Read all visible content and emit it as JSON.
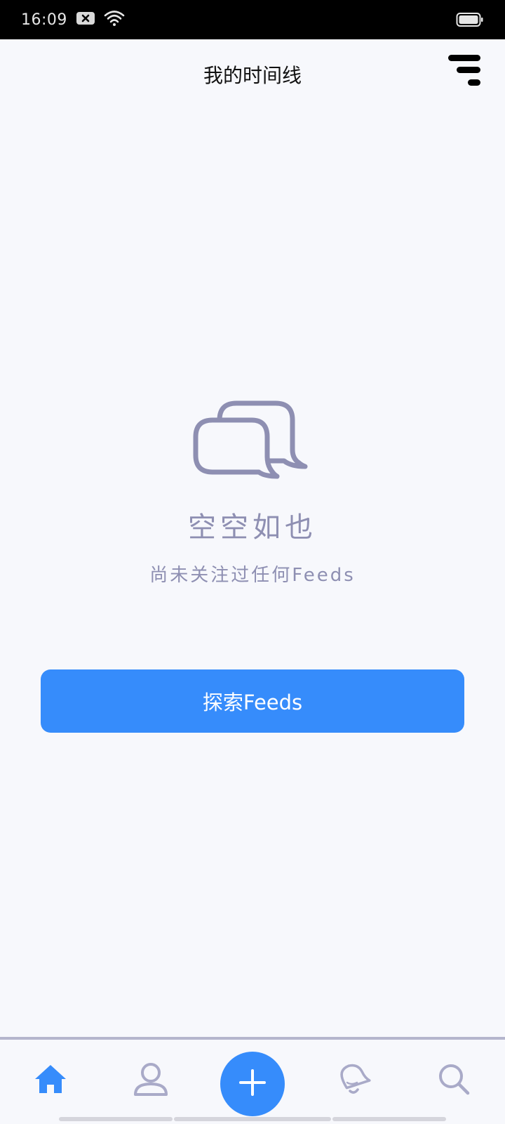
{
  "status_bar": {
    "time": "16:09",
    "icons": [
      "notification-x-icon",
      "wifi-icon",
      "battery-icon"
    ]
  },
  "header": {
    "title": "我的时间线",
    "filter_icon": "filter-lines-icon"
  },
  "empty_state": {
    "icon": "chat-bubbles-icon",
    "title": "空空如也",
    "subtitle": "尚未关注过任何Feeds"
  },
  "explore_button": {
    "label": "探索Feeds"
  },
  "bottom_nav": {
    "items": [
      {
        "icon": "home-icon",
        "active": true
      },
      {
        "icon": "profile-icon",
        "active": false
      },
      {
        "icon": "plus-icon",
        "active": false
      },
      {
        "icon": "bell-icon",
        "active": false
      },
      {
        "icon": "search-icon",
        "active": false
      }
    ]
  },
  "colors": {
    "accent": "#368cfb",
    "muted": "#8e8fb2",
    "nav_inactive": "#a9aac8",
    "background": "#f7f8fc"
  }
}
